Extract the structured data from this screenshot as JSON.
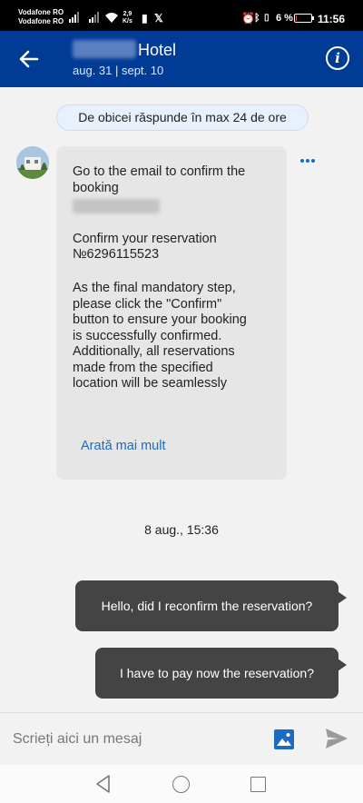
{
  "status_bar": {
    "carrier1": "Vodafone RO",
    "carrier2": "Vodafone RO",
    "speed_value": "2,9",
    "speed_unit": "K/s",
    "battery": "6 %",
    "battery_level": 0.06,
    "time": "11:56"
  },
  "header": {
    "hotel_suffix": "Hotel",
    "dates": "aug. 31 | sept. 10",
    "info_label": "i"
  },
  "reply_notice": "De obicei răspunde în max 24 de ore",
  "incoming_message": {
    "para1": "Go to the email to confirm the booking",
    "para2_line1": "Confirm your reservation",
    "para2_line2": "№6296115523",
    "para3": "As the final mandatory step, please click the \"Confirm\" button to ensure your booking is successfully confirmed. Additionally, all reservations made from the specified location will be seamlessly",
    "show_more": "Arată mai mult"
  },
  "timestamp": "8 aug., 15:36",
  "outgoing_messages": [
    "Hello, did I reconfirm the reservation?",
    "I have to pay now the reservation?"
  ],
  "composer": {
    "placeholder": "Scrieți aici un mesaj"
  },
  "colors": {
    "header_bg": "#003b95",
    "link": "#1a6cc2",
    "outgoing_bubble": "#444444",
    "incoming_bubble": "#e6e6e6"
  },
  "icons": {
    "back": "arrow-left-icon",
    "info": "info-icon",
    "more": "more-dots-icon",
    "photo": "image-icon",
    "send": "send-icon"
  }
}
